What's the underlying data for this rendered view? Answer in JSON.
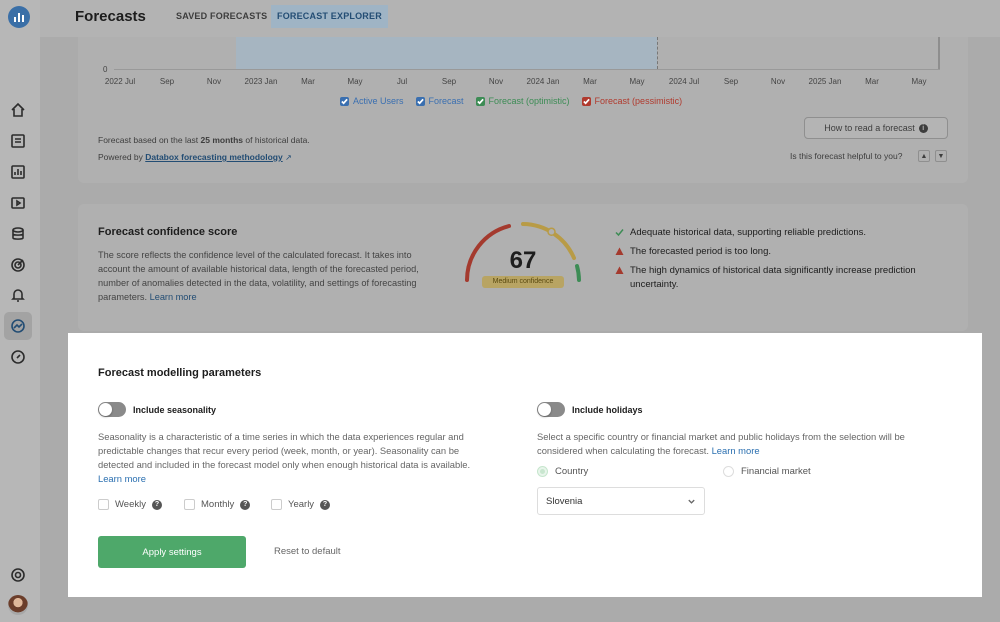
{
  "header": {
    "title": "Forecasts",
    "tabs": [
      {
        "label": "SAVED FORECASTS",
        "active": false
      },
      {
        "label": "FORECAST EXPLORER",
        "active": true
      }
    ]
  },
  "sidebar": {
    "icons": [
      "home-icon",
      "number-tile-icon",
      "dashboard-icon",
      "play-icon",
      "database-icon",
      "target-icon",
      "bell-icon",
      "forecast-icon",
      "compass-icon",
      "support-icon"
    ],
    "active": "forecast-icon"
  },
  "chart": {
    "y_zero": "0",
    "x_ticks": [
      "2022 Jul",
      "Sep",
      "Nov",
      "2023 Jan",
      "Mar",
      "May",
      "Jul",
      "Sep",
      "Nov",
      "2024 Jan",
      "Mar",
      "May",
      "2024 Jul",
      "Sep",
      "Nov",
      "2025 Jan",
      "Mar",
      "May"
    ],
    "legend": [
      {
        "label": "Active Users",
        "color": "#3a6fb0"
      },
      {
        "label": "Forecast",
        "color": "#3a6fb0"
      },
      {
        "label": "Forecast (optimistic)",
        "color": "#3d8c55"
      },
      {
        "label": "Forecast (pessimistic)",
        "color": "#b03a2e"
      }
    ]
  },
  "forecast_info": {
    "basis_prefix": "Forecast based on the last ",
    "basis_value": "25 months",
    "basis_suffix": " of historical data.",
    "powered_prefix": "Powered by ",
    "powered_link": "Databox forecasting methodology",
    "howto_label": "How to read a forecast",
    "helpful_question": "Is this forecast helpful to you?"
  },
  "confidence": {
    "title": "Forecast confidence score",
    "description": "The score reflects the confidence level of the calculated forecast. It takes into account the amount of available historical data, length of the forecasted period, number of anomalies detected in the data, volatility, and settings of forecasting parameters.",
    "learn_more": "Learn more",
    "score": "67",
    "score_fraction": 0.67,
    "badge": "Medium confidence",
    "checks": [
      {
        "type": "ok",
        "text": "Adequate historical data, supporting reliable predictions."
      },
      {
        "type": "warn",
        "text": "The forecasted period is too long."
      },
      {
        "type": "warn",
        "text": "The high dynamics of historical data significantly increase prediction uncertainty."
      }
    ]
  },
  "params": {
    "title": "Forecast modelling parameters",
    "seasonality": {
      "label": "Include seasonality",
      "enabled": false,
      "description": "Seasonality is a characteristic of a time series in which the data experiences regular and predictable changes that recur every period (week, month, or year). Seasonality can be detected and included in the forecast model only when enough historical data is available.",
      "learn_more": "Learn more",
      "options": [
        "Weekly",
        "Monthly",
        "Yearly"
      ]
    },
    "holidays": {
      "label": "Include holidays",
      "enabled": false,
      "description": "Select a specific country or financial market and public holidays from the selection will be considered when calculating the forecast.",
      "learn_more": "Learn more",
      "radio_country": "Country",
      "radio_market": "Financial market",
      "selected_country": "Slovenia"
    },
    "apply_label": "Apply settings",
    "reset_label": "Reset to default"
  }
}
